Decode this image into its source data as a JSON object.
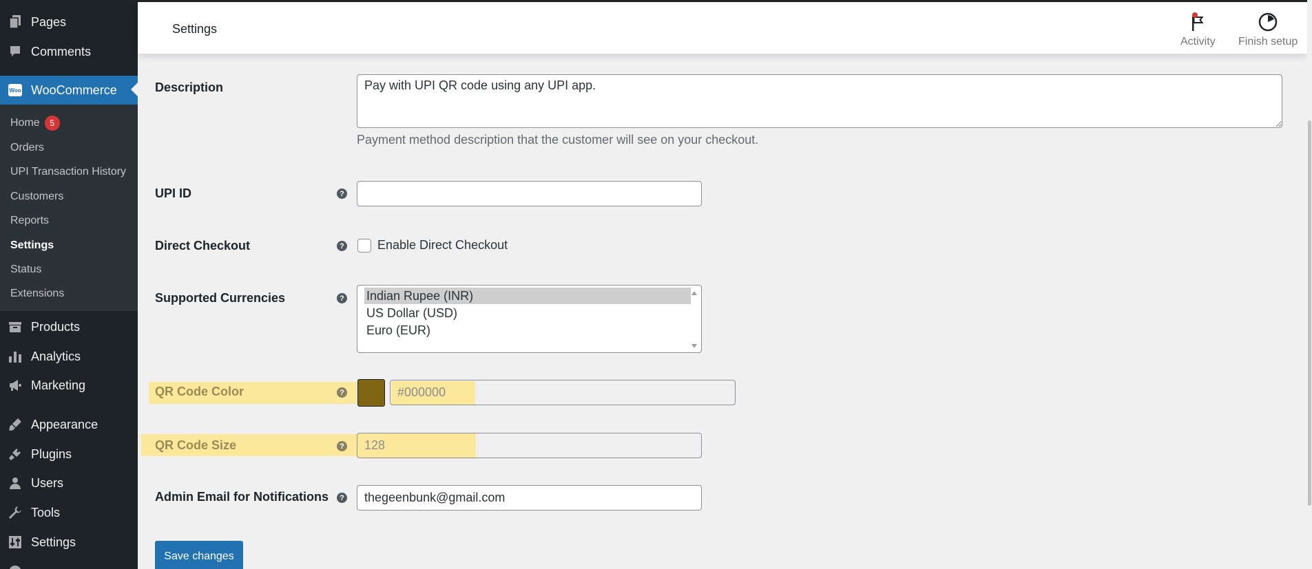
{
  "sidebar": {
    "menu_top": [
      {
        "label": "Pages",
        "icon": "pages-icon"
      },
      {
        "label": "Comments",
        "icon": "comments-icon"
      }
    ],
    "woocommerce": {
      "label": "WooCommerce",
      "icon_text": "Woo"
    },
    "woo_submenu": [
      {
        "label": "Home",
        "badge": "5"
      },
      {
        "label": "Orders"
      },
      {
        "label": "UPI Transaction History"
      },
      {
        "label": "Customers"
      },
      {
        "label": "Reports"
      },
      {
        "label": "Settings",
        "current": true
      },
      {
        "label": "Status"
      },
      {
        "label": "Extensions"
      }
    ],
    "menu_bottom": [
      {
        "label": "Products",
        "icon": "products-icon"
      },
      {
        "label": "Analytics",
        "icon": "analytics-icon"
      },
      {
        "label": "Marketing",
        "icon": "marketing-icon"
      },
      {
        "label": "Appearance",
        "icon": "appearance-icon"
      },
      {
        "label": "Plugins",
        "icon": "plugins-icon"
      },
      {
        "label": "Users",
        "icon": "users-icon"
      },
      {
        "label": "Tools",
        "icon": "tools-icon"
      },
      {
        "label": "Settings",
        "icon": "settings-icon"
      }
    ]
  },
  "header": {
    "title": "Settings",
    "activity_label": "Activity",
    "finish_setup_label": "Finish setup"
  },
  "form": {
    "description": {
      "label": "Description",
      "value": "Pay with UPI QR code using any UPI app.",
      "hint": "Payment method description that the customer will see on your checkout."
    },
    "upi_id": {
      "label": "UPI ID",
      "value": ""
    },
    "direct_checkout": {
      "label": "Direct Checkout",
      "checkbox_label": "Enable Direct Checkout",
      "checked": false
    },
    "supported_currencies": {
      "label": "Supported Currencies",
      "options": [
        "Indian Rupee (INR)",
        "US Dollar (USD)",
        "Euro (EUR)"
      ],
      "selected": "Indian Rupee (INR)"
    },
    "qr_color": {
      "label": "QR Code Color",
      "placeholder": "#000000",
      "swatch_color": "#806612"
    },
    "qr_size": {
      "label": "QR Code Size",
      "placeholder": "128"
    },
    "admin_email": {
      "label": "Admin Email for Notifications",
      "value": "thegeenbunk@gmail.com"
    },
    "save_label": "Save changes"
  },
  "colors": {
    "sidebar_bg": "#1d2327",
    "accent": "#2271b1",
    "highlight": "#fbe89a",
    "badge": "#d63638"
  }
}
